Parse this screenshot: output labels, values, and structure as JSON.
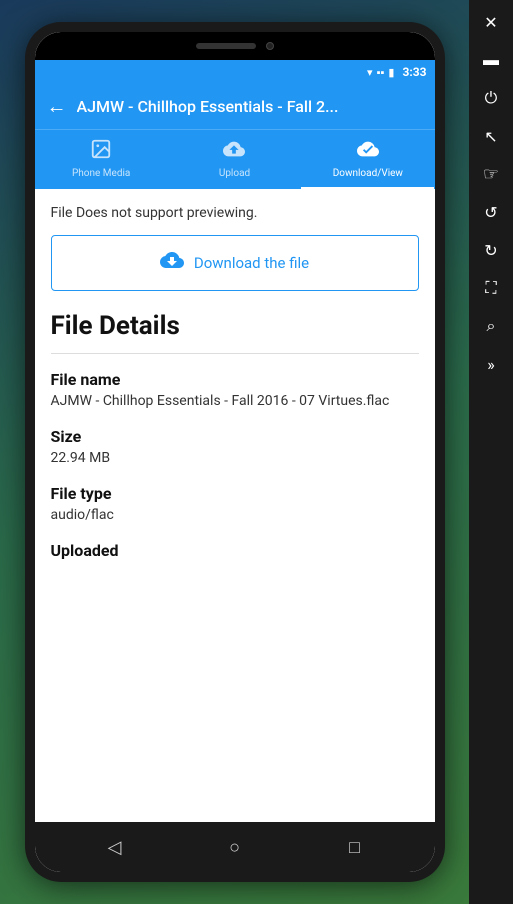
{
  "status_bar": {
    "time": "3:33",
    "wifi_icon": "▾",
    "signal_icon": "▪",
    "battery_icon": "▮"
  },
  "header": {
    "back_icon": "←",
    "title": "AJMW - Chillhop Essentials - Fall 2..."
  },
  "tabs": [
    {
      "id": "phone-media",
      "label": "Phone Media",
      "icon": "🖼",
      "active": false
    },
    {
      "id": "upload",
      "label": "Upload",
      "icon": "☁",
      "active": false
    },
    {
      "id": "download-view",
      "label": "Download/View",
      "icon": "☁",
      "active": true
    }
  ],
  "content": {
    "no_preview": "File Does not support previewing.",
    "download_button_label": "Download the file",
    "download_icon": "☁",
    "file_details_title": "File Details",
    "fields": [
      {
        "label": "File name",
        "value": "AJMW - Chillhop Essentials - Fall 2016 - 07 Virtues.flac"
      },
      {
        "label": "Size",
        "value": "22.94 MB"
      },
      {
        "label": "File type",
        "value": "audio/flac"
      },
      {
        "label": "Uploaded",
        "value": ""
      }
    ]
  },
  "bottom_nav": {
    "back_icon": "◁",
    "home_icon": "○",
    "recent_icon": "□"
  },
  "side_toolbar": {
    "buttons": [
      {
        "icon": "✕",
        "name": "close"
      },
      {
        "icon": "▬",
        "name": "minimize"
      },
      {
        "icon": "⏻",
        "name": "power"
      },
      {
        "icon": "↖",
        "name": "pointer"
      },
      {
        "icon": "☞",
        "name": "touch"
      },
      {
        "icon": "↺",
        "name": "rotate-ccw"
      },
      {
        "icon": "↻",
        "name": "rotate-cw"
      },
      {
        "icon": "⛶",
        "name": "fullscreen"
      },
      {
        "icon": "⌕",
        "name": "zoom"
      },
      {
        "icon": "»",
        "name": "forward"
      }
    ]
  }
}
